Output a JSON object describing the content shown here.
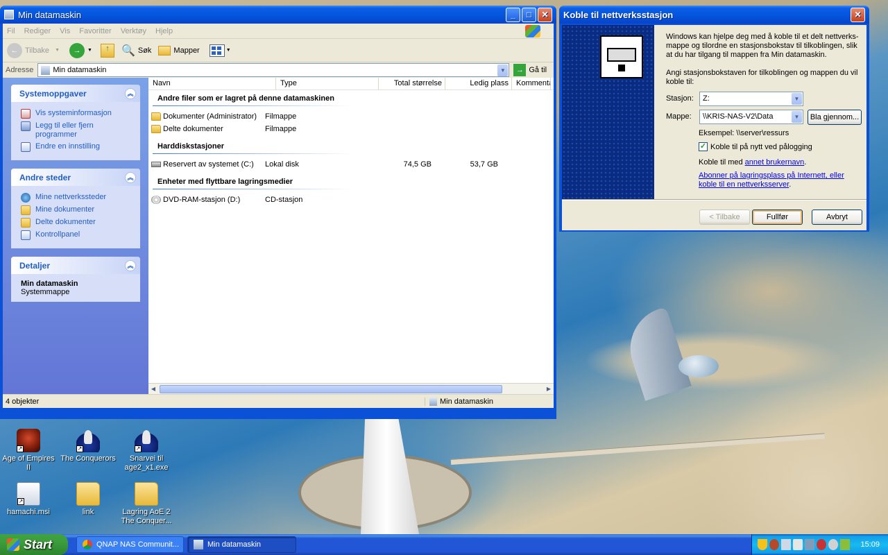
{
  "explorer": {
    "title": "Min datamaskin",
    "menu": [
      "Fil",
      "Rediger",
      "Vis",
      "Favoritter",
      "Verktøy",
      "Hjelp"
    ],
    "toolbar": {
      "back": "Tilbake",
      "search": "Søk",
      "folders": "Mapper"
    },
    "address": {
      "label": "Adresse",
      "value": "Min datamaskin",
      "go": "Gå til"
    },
    "tasks": {
      "system": {
        "title": "Systemoppgaver",
        "items": [
          "Vis systeminformasjon",
          "Legg til eller fjern programmer",
          "Endre en innstilling"
        ]
      },
      "places": {
        "title": "Andre steder",
        "items": [
          "Mine nettverkssteder",
          "Mine dokumenter",
          "Delte dokumenter",
          "Kontrollpanel"
        ]
      },
      "details": {
        "title": "Detaljer",
        "name": "Min datamaskin",
        "type": "Systemmappe"
      }
    },
    "columns": [
      "Navn",
      "Type",
      "Total størrelse",
      "Ledig plass",
      "Kommenta"
    ],
    "groups": [
      {
        "title": "Andre filer som er lagret på denne datamaskinen",
        "rows": [
          {
            "name": "Dokumenter (Administrator)",
            "type": "Filmappe",
            "total": "",
            "free": ""
          },
          {
            "name": "Delte dokumenter",
            "type": "Filmappe",
            "total": "",
            "free": ""
          }
        ]
      },
      {
        "title": "Harddiskstasjoner",
        "rows": [
          {
            "name": "Reservert av systemet (C:)",
            "type": "Lokal disk",
            "total": "74,5 GB",
            "free": "53,7 GB"
          }
        ]
      },
      {
        "title": "Enheter med flyttbare lagringsmedier",
        "rows": [
          {
            "name": "DVD-RAM-stasjon (D:)",
            "type": "CD-stasjon",
            "total": "",
            "free": ""
          }
        ]
      }
    ],
    "status": {
      "count": "4 objekter",
      "location": "Min datamaskin"
    }
  },
  "dialog": {
    "title": "Koble til nettverksstasjon",
    "intro": "Windows kan hjelpe deg med å koble til et delt nettverks-mappe og tilordne en stasjonsbokstav til tilkoblingen, slik at du har tilgang til mappen fra Min datamaskin.",
    "prompt": "Angi stasjonsbokstaven for tilkoblingen og mappen du vil koble til:",
    "drive_label": "Stasjon:",
    "drive_value": "Z:",
    "folder_label": "Mappe:",
    "folder_value": "\\\\KRIS-NAS-V2\\Data",
    "browse": "Bla gjennom...",
    "example": "Eksempel: \\\\server\\ressurs",
    "reconnect": "Koble til på nytt ved pålogging",
    "reconnect_checked": true,
    "other_user_prefix": "Koble til med ",
    "other_user_link": "annet brukernavn",
    "other_user_suffix": ".",
    "storage_link": "Abonner på lagringsplass på Internett, eller koble til en nettverksserver",
    "storage_suffix": ".",
    "back": "< Tilbake",
    "finish": "Fullfør",
    "cancel": "Avbryt"
  },
  "desktop_icons": [
    {
      "label": "Age of Empires II"
    },
    {
      "label": "The Conquerors"
    },
    {
      "label": "Snarvei til age2_x1.exe"
    },
    {
      "label": "hamachi.msi"
    },
    {
      "label": "link"
    },
    {
      "label": "Lagring AoE 2 The Conquer..."
    }
  ],
  "taskbar": {
    "start": "Start",
    "tasks": [
      "QNAP NAS Communit...",
      "Min datamaskin"
    ],
    "clock": "15:09"
  }
}
